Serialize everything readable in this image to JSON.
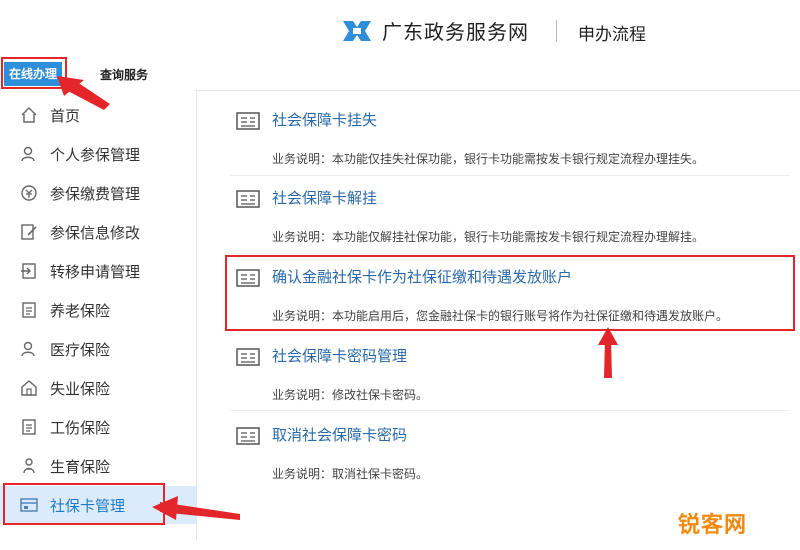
{
  "header": {
    "site_name": "广东政务服务网",
    "section": "申办流程",
    "logo_icon": "gdzwfw-logo-icon"
  },
  "tabs": [
    {
      "label": "在线办理",
      "active": true
    },
    {
      "label": "查询服务",
      "active": false
    }
  ],
  "sidebar": {
    "items": [
      {
        "label": "首页",
        "icon": "home-icon"
      },
      {
        "label": "个人参保管理",
        "icon": "person-icon"
      },
      {
        "label": "参保缴费管理",
        "icon": "payment-icon"
      },
      {
        "label": "参保信息修改",
        "icon": "edit-icon"
      },
      {
        "label": "转移申请管理",
        "icon": "transfer-icon"
      },
      {
        "label": "养老保险",
        "icon": "document-icon"
      },
      {
        "label": "医疗保险",
        "icon": "person-icon"
      },
      {
        "label": "失业保险",
        "icon": "house-icon"
      },
      {
        "label": "工伤保险",
        "icon": "document-icon"
      },
      {
        "label": "生育保险",
        "icon": "baby-icon"
      },
      {
        "label": "社保卡管理",
        "icon": "card-icon",
        "active": true
      }
    ]
  },
  "services": [
    {
      "title": "社会保障卡挂失",
      "desc": "业务说明：本功能仅挂失社保功能，银行卡功能需按发卡银行规定流程办理挂失。"
    },
    {
      "title": "社会保障卡解挂",
      "desc": "业务说明：本功能仅解挂社保功能，银行卡功能需按发卡银行规定流程办理解挂。"
    },
    {
      "title": "确认金融社保卡作为社保征缴和待遇发放账户",
      "desc": "业务说明：本功能启用后，您金融社保卡的银行账号将作为社保征缴和待遇发放账户。",
      "highlighted": true
    },
    {
      "title": "社会保障卡密码管理",
      "desc": "业务说明：修改社保卡密码。"
    },
    {
      "title": "取消社会保障卡密码",
      "desc": "业务说明：取消社保卡密码。"
    }
  ],
  "watermark": "锐客网",
  "colors": {
    "accent": "#2f8ed9",
    "annotation": "#e3262a",
    "link": "#2a6aa8",
    "watermark": "#f28a12"
  }
}
